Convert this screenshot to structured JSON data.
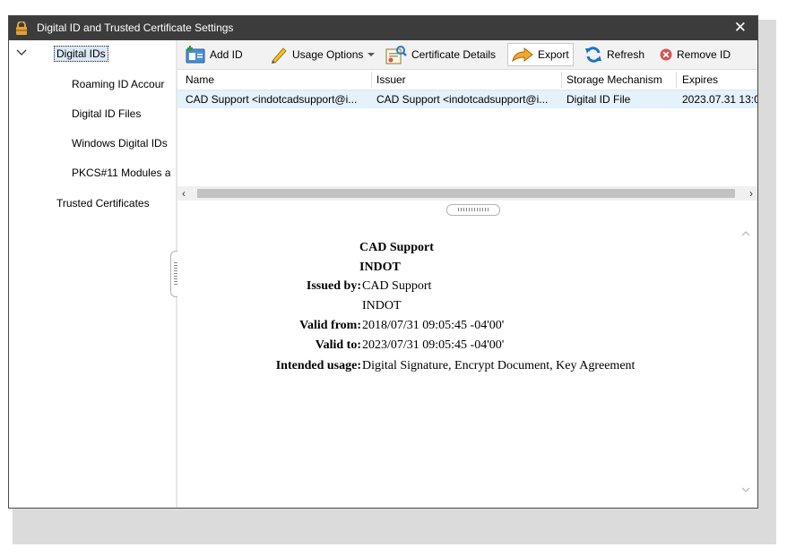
{
  "window": {
    "title": "Digital ID and Trusted Certificate Settings",
    "close_glyph": "✕"
  },
  "sidebar": {
    "items": [
      {
        "label": "Digital IDs"
      },
      {
        "label": "Roaming ID Accour"
      },
      {
        "label": "Digital ID Files"
      },
      {
        "label": "Windows Digital IDs"
      },
      {
        "label": "PKCS#11 Modules a"
      },
      {
        "label": "Trusted Certificates"
      }
    ]
  },
  "toolbar": {
    "add_id": "Add ID",
    "usage_options": "Usage Options",
    "certificate_details": "Certificate Details",
    "export": "Export",
    "refresh": "Refresh",
    "remove_id": "Remove ID"
  },
  "table": {
    "columns": [
      "Name",
      "Issuer",
      "Storage Mechanism",
      "Expires"
    ],
    "rows": [
      [
        "CAD Support <indotcadsupport@i...",
        "CAD Support <indotcadsupport@i...",
        "Digital ID File",
        "2023.07.31 13:0"
      ]
    ]
  },
  "details": {
    "name_line1": "CAD Support",
    "name_line2": "INDOT",
    "issued_by_label": "Issued by:",
    "issued_by_line1": "CAD Support",
    "issued_by_line2": "INDOT",
    "valid_from_label": "Valid from:",
    "valid_from": "2018/07/31 09:05:45 -04'00'",
    "valid_to_label": "Valid to:",
    "valid_to": "2023/07/31 09:05:45 -04'00'",
    "intended_usage_label": "Intended usage:",
    "intended_usage": "Digital Signature, Encrypt Document, Key Agreement"
  },
  "colors": {
    "titlebar": "#3c3c3c",
    "selected_row": "#e5f1fb",
    "lock_icon": "#e0a23a",
    "remove_icon": "#d9534f",
    "refresh_icon": "#1a73c7"
  }
}
